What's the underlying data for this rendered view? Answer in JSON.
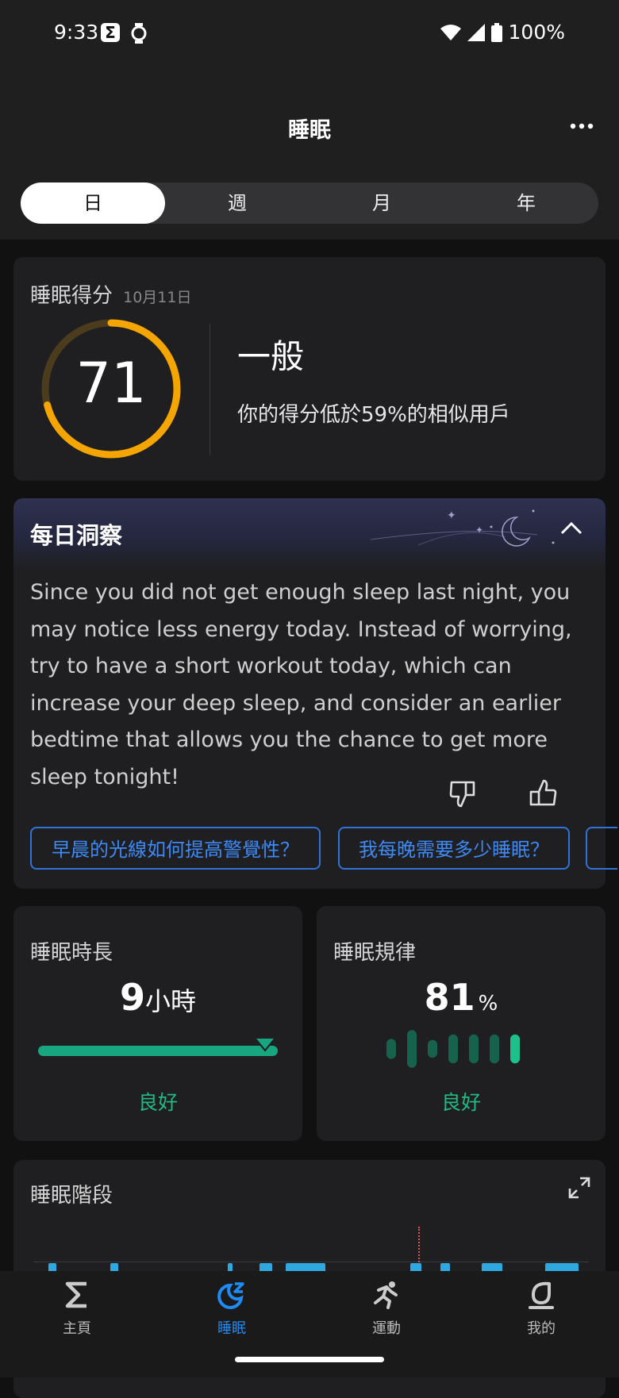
{
  "status_bar": {
    "time": "9:33",
    "battery": "100%"
  },
  "header": {
    "title": "睡眠",
    "more_icon": "more-horizontal-icon"
  },
  "tabs": [
    {
      "label": "日",
      "active": true
    },
    {
      "label": "週"
    },
    {
      "label": "月"
    },
    {
      "label": "年"
    }
  ],
  "score_card": {
    "title": "睡眠得分",
    "date": "10月11日",
    "score": 71,
    "score_fraction": 0.71,
    "rating": "一般",
    "description": "你的得分低於59%的相似用戶",
    "ring_color": "#f5a500"
  },
  "insight": {
    "title": "每日洞察",
    "text": "Since you did not get enough sleep last night, you may notice less energy today. Instead of worrying, try to have a short workout today, which can increase your deep sleep, and consider an earlier bedtime that allows you the chance to get more sleep tonight!",
    "questions": [
      "早晨的光線如何提高警覺性？",
      "我每晚需要多少睡眠？"
    ]
  },
  "duration": {
    "title": "睡眠時長",
    "value": "9",
    "unit": "小時",
    "status": "良好",
    "fill_fraction": 1.0
  },
  "regularity": {
    "title": "睡眠規律",
    "value": "81",
    "unit": "%",
    "status": "良好",
    "bar_levels": [
      0.45,
      0.85,
      0.4,
      0.65,
      0.65,
      0.65,
      0.65
    ]
  },
  "stages": {
    "title": "睡眠階段"
  },
  "nav": [
    {
      "label": "主頁",
      "icon": "sigma-icon",
      "active": false
    },
    {
      "label": "睡眠",
      "icon": "moon-sleep-icon",
      "active": true
    },
    {
      "label": "運動",
      "icon": "running-icon",
      "active": false
    },
    {
      "label": "我的",
      "icon": "profile-icon",
      "active": false
    }
  ],
  "colors": {
    "accent_blue": "#1f8cf5",
    "good_green": "#22b983",
    "score_orange": "#f5a500"
  }
}
